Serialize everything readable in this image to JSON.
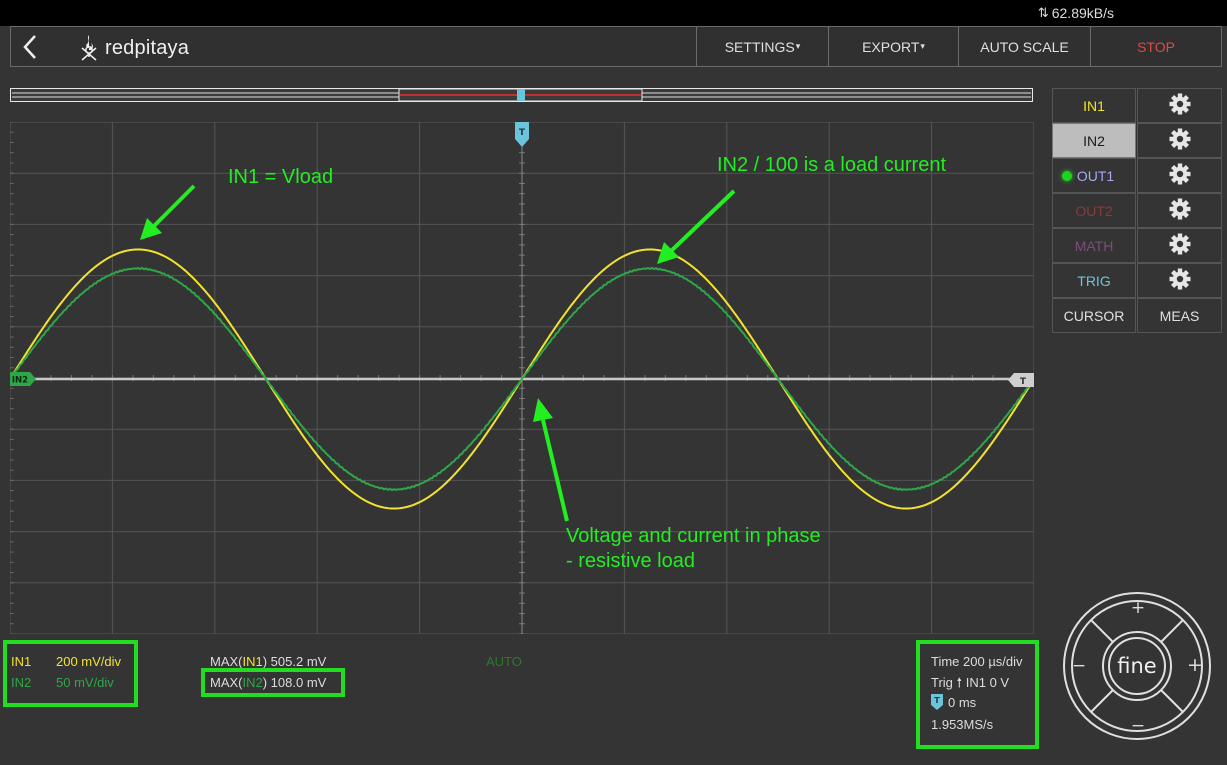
{
  "status_bar": {
    "net_rate": "62.89kB/s"
  },
  "nav": {
    "logo_text": "redpitaya",
    "settings": "SETTINGS",
    "export": "EXPORT",
    "autoscale": "AUTO SCALE",
    "stop": "STOP"
  },
  "colors": {
    "in1": "#f2e32e",
    "in2": "#2fa64a",
    "trig": "#6cc4da",
    "out2": "#8a3a3a",
    "math": "#7a4e7a",
    "out1": "#a9a9f0",
    "highlight": "#22dd22"
  },
  "channels": [
    {
      "label": "IN1",
      "icon": "gear-icon"
    },
    {
      "label": "IN2",
      "icon": "gear-icon"
    },
    {
      "label": "OUT1",
      "icon": "gear-icon"
    },
    {
      "label": "OUT2",
      "icon": "gear-icon"
    },
    {
      "label": "MATH",
      "icon": "gear-icon"
    },
    {
      "label": "TRIG",
      "icon": "gear-icon"
    }
  ],
  "tools": {
    "cursor": "CURSOR",
    "meas": "MEAS"
  },
  "markers": {
    "trigger": "T",
    "in2_offset": "IN2",
    "trigger_level": "T"
  },
  "scale": {
    "in1_label": "IN1",
    "in1_value": "200 mV/div",
    "in2_label": "IN2",
    "in2_value": "50 mV/div"
  },
  "measurements": {
    "max_in1_prefix": "MAX(",
    "max_in1_ch": "IN1",
    "max_in1_suffix": ") 505.2 mV",
    "max_in2_prefix": "MAX(",
    "max_in2_ch": "IN2",
    "max_in2_suffix": ") 108.0 mV"
  },
  "acq_mode": "AUTO",
  "timebase": {
    "time": "Time 200 µs/div",
    "trig_prefix": "Trig",
    "trig_value": "IN1 0 V",
    "delay": "0 ms",
    "sample_rate": "1.953MS/s"
  },
  "joystick": {
    "center": "fine",
    "up": "+",
    "down": "−",
    "left": "−",
    "right": "+"
  },
  "annotations": {
    "in1": "IN1 = Vload",
    "in2": "IN2 / 100 is a load current",
    "phase_line1": "Voltage and current in phase",
    "phase_line2": "- resistive load"
  },
  "chart_data": {
    "type": "line",
    "x_divisions": 10,
    "y_divisions": 10,
    "grid": true,
    "series": [
      {
        "name": "IN1",
        "color": "#f2e32e",
        "amplitude_div": 2.53,
        "period_div": 5.0,
        "phase_deg": 0
      },
      {
        "name": "IN2",
        "color": "#2fa64a",
        "amplitude_div": 2.16,
        "period_div": 5.0,
        "phase_deg": 0
      }
    ]
  }
}
